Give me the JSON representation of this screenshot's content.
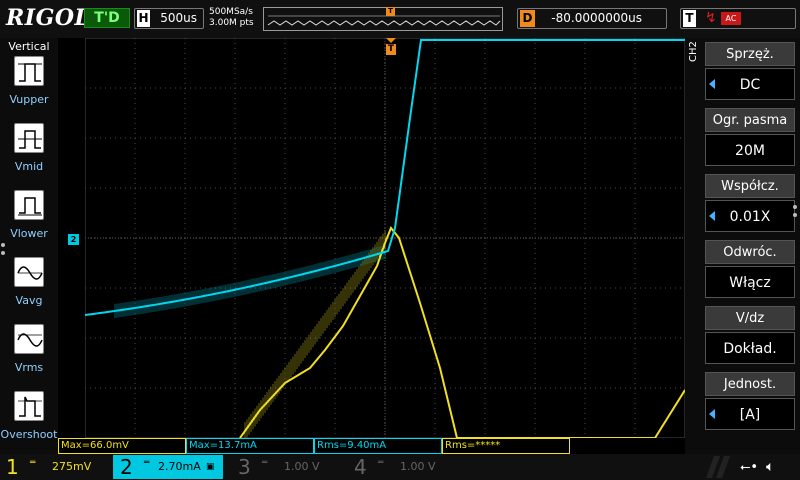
{
  "header": {
    "logo": "RIGOL",
    "run_status": "T'D",
    "horizontal": {
      "letter": "H",
      "timebase": "500us"
    },
    "sample_rate": "500MSa/s",
    "memory_depth": "3.00M pts",
    "trigger_marker": "T",
    "delay": {
      "letter": "D",
      "value": "-80.0000000us"
    },
    "trigger": {
      "letter": "T",
      "edge_icon": "rising-edge-icon",
      "source": "AC"
    }
  },
  "left_menu": {
    "title": "Vertical",
    "items": [
      {
        "label": "Vupper",
        "icon": "vupper-icon"
      },
      {
        "label": "Vmid",
        "icon": "vmid-icon"
      },
      {
        "label": "Vlower",
        "icon": "vlower-icon"
      },
      {
        "label": "Vavg",
        "icon": "vavg-icon"
      },
      {
        "label": "Vrms",
        "icon": "vrms-icon"
      },
      {
        "label": "Overshoot",
        "icon": "overshoot-icon"
      }
    ]
  },
  "waveform": {
    "ch2_marker": "2",
    "trigger_position_marker": "T",
    "colors": {
      "ch1": "#f0e020",
      "ch2": "#00d8f0",
      "trigger": "#f08a1c",
      "grid": "#4a4a4a"
    }
  },
  "measurements": [
    {
      "text": "Max=66.0mV",
      "channel": 1
    },
    {
      "text": "Max=13.7mA",
      "channel": 2
    },
    {
      "text": "Rms=9.40mA",
      "channel": 2
    },
    {
      "text": "Rms=*****",
      "channel": 1
    }
  ],
  "right_menu": {
    "channel_label": "CH2",
    "items": [
      {
        "title": "Sprzęż.",
        "value": "DC",
        "has_arrow": true
      },
      {
        "title": "Ogr. pasma",
        "value": "20M",
        "has_arrow": false
      },
      {
        "title": "Współcz.",
        "value": "0.01X",
        "has_arrow": true
      },
      {
        "title": "Odwróc.",
        "value": "Włącz",
        "has_arrow": false
      },
      {
        "title": "V/dz",
        "value": "Dokład.",
        "has_arrow": false
      },
      {
        "title": "Jednost.",
        "value": "[A]",
        "has_arrow": true
      }
    ]
  },
  "bottom": {
    "channels": [
      {
        "number": "1",
        "scale": "275mV",
        "color": "#f0e020"
      },
      {
        "number": "2",
        "scale": "2.70mA",
        "color": "#00d8f0"
      },
      {
        "number": "3",
        "scale": "1.00 V",
        "color": "#666666"
      },
      {
        "number": "4",
        "scale": "1.00 V",
        "color": "#666666"
      }
    ],
    "usb_icon": "usb-icon",
    "sound_icon": "speaker-muted-icon"
  }
}
